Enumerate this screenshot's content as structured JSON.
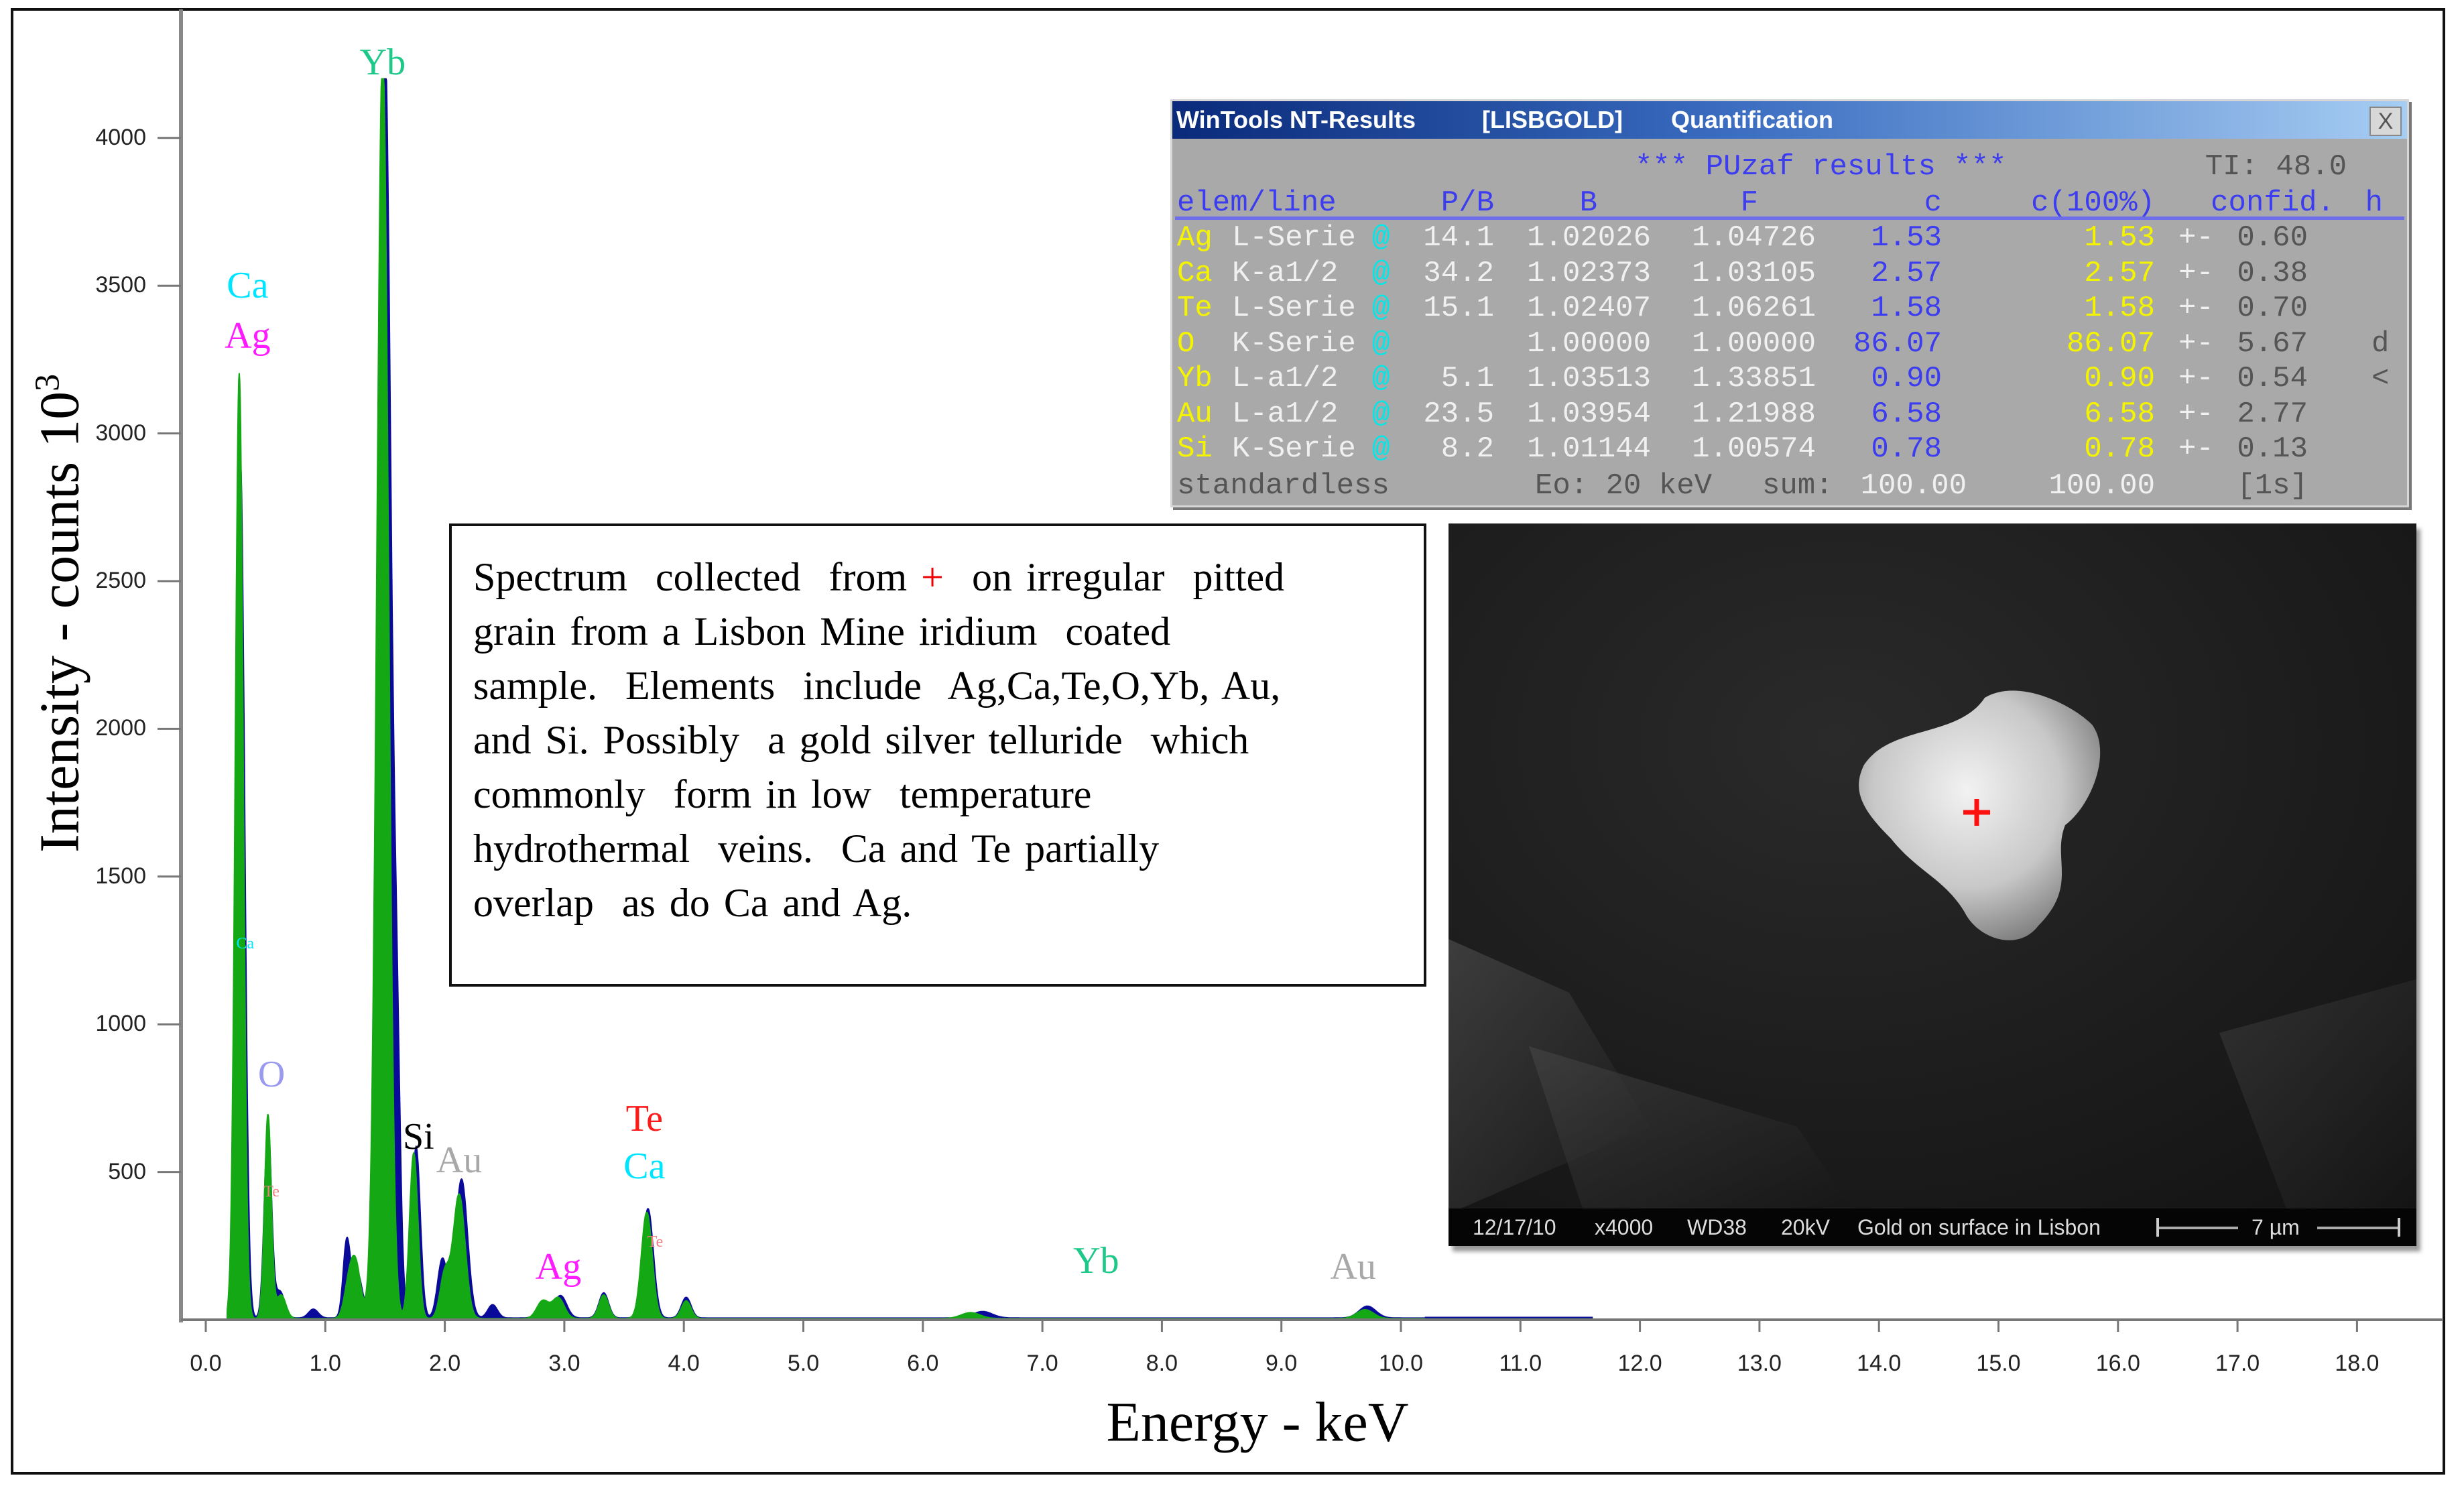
{
  "chart_data": {
    "type": "area",
    "title": "",
    "xlabel": "Energy - keV",
    "ylabel_main": "Intensity - counts 10",
    "ylabel_sup": "3",
    "xlim": [
      -0.3,
      19.0
    ],
    "ylim": [
      0,
      4200
    ],
    "x_ticks": [
      "0.0",
      "1.0",
      "2.0",
      "3.0",
      "4.0",
      "5.0",
      "6.0",
      "7.0",
      "8.0",
      "9.0",
      "10.0",
      "11.0",
      "12.0",
      "13.0",
      "14.0",
      "15.0",
      "16.0",
      "17.0",
      "18.0"
    ],
    "y_ticks": [
      "500",
      "1000",
      "1500",
      "2000",
      "2500",
      "3000",
      "3500",
      "4000"
    ],
    "series": [
      {
        "name": "spectrum-overlay",
        "color": "#0a0a9a",
        "peaks": [
          [
            0.29,
            2900,
            0.035
          ],
          [
            0.52,
            650,
            0.03
          ],
          [
            0.62,
            90,
            0.04
          ],
          [
            0.9,
            30,
            0.04
          ],
          [
            1.18,
            260,
            0.03
          ],
          [
            1.27,
            150,
            0.04
          ],
          [
            1.5,
            4300,
            0.05
          ],
          [
            1.6,
            700,
            0.03
          ],
          [
            1.76,
            580,
            0.035
          ],
          [
            1.98,
            200,
            0.04
          ],
          [
            2.14,
            470,
            0.05
          ],
          [
            2.4,
            45,
            0.04
          ],
          [
            2.83,
            55,
            0.05
          ],
          [
            2.97,
            75,
            0.05
          ],
          [
            3.33,
            85,
            0.04
          ],
          [
            3.7,
            370,
            0.045
          ],
          [
            4.02,
            70,
            0.04
          ],
          [
            6.5,
            22,
            0.08
          ],
          [
            9.72,
            40,
            0.07
          ],
          [
            11.5,
            12,
            0.1
          ]
        ]
      },
      {
        "name": "spectrum",
        "color": "#14a814",
        "peaks": [
          [
            0.28,
            3200,
            0.033
          ],
          [
            0.52,
            690,
            0.028
          ],
          [
            0.63,
            80,
            0.04
          ],
          [
            1.2,
            120,
            0.04
          ],
          [
            1.26,
            160,
            0.04
          ],
          [
            1.48,
            4300,
            0.048
          ],
          [
            1.74,
            560,
            0.035
          ],
          [
            2.0,
            150,
            0.04
          ],
          [
            2.12,
            420,
            0.05
          ],
          [
            2.82,
            60,
            0.05
          ],
          [
            2.95,
            70,
            0.05
          ],
          [
            3.33,
            80,
            0.04
          ],
          [
            3.69,
            360,
            0.045
          ],
          [
            4.02,
            60,
            0.04
          ],
          [
            6.4,
            20,
            0.08
          ],
          [
            9.7,
            30,
            0.07
          ]
        ]
      }
    ],
    "annotations": [
      {
        "text": "Yb",
        "keV": 1.48,
        "counts": 4290,
        "color": "#1ec888"
      },
      {
        "text": "Ca",
        "keV": 0.35,
        "counts": 3500,
        "color": "#00e5ff"
      },
      {
        "text": "Ag",
        "keV": 0.35,
        "counts": 3330,
        "color": "#ff1aff"
      },
      {
        "text": "Ca",
        "keV": 0.33,
        "counts": 1270,
        "color": "#00e5ff",
        "small": true
      },
      {
        "text": "O",
        "keV": 0.55,
        "counts": 830,
        "color": "#9a9af0"
      },
      {
        "text": "Te",
        "keV": 0.55,
        "counts": 430,
        "color": "#f08080",
        "small": true
      },
      {
        "text": "Si",
        "keV": 1.78,
        "counts": 620,
        "color": "#000000"
      },
      {
        "text": "Au",
        "keV": 2.12,
        "counts": 540,
        "color": "#a8a8a8"
      },
      {
        "text": "Te",
        "keV": 3.67,
        "counts": 680,
        "color": "#ff1a1a"
      },
      {
        "text": "Ca",
        "keV": 3.67,
        "counts": 520,
        "color": "#00e5ff"
      },
      {
        "text": "Te",
        "keV": 3.76,
        "counts": 260,
        "color": "#f08080",
        "small": true
      },
      {
        "text": "Ag",
        "keV": 2.95,
        "counts": 180,
        "color": "#ff1aff"
      },
      {
        "text": "Yb",
        "keV": 7.45,
        "counts": 200,
        "color": "#1ec888"
      },
      {
        "text": "Au",
        "keV": 9.6,
        "counts": 180,
        "color": "#a8a8a8"
      }
    ]
  },
  "note": {
    "line1_pre": "Spectrum  collected  from ",
    "line1_plus": "+",
    "line1_post": "  on irregular  pitted",
    "lines": [
      "grain from a Lisbon Mine iridium  coated",
      "sample.  Elements  include  Ag,Ca,Te,O,Yb, Au,",
      "and Si. Possibly  a gold silver telluride  which",
      "commonly  form in low  temperature",
      "hydrothermal  veins.  Ca and Te partially",
      "overlap  as do Ca and Ag."
    ]
  },
  "quant": {
    "title_app": "WinTools NT-Results",
    "title_file": "[LISBGOLD]",
    "title_mode": "Quantification",
    "close": "X",
    "results_title": "*** PUzaf results ***",
    "ti": "TI: 48.0",
    "headers": [
      "elem/line",
      "P/B",
      "B",
      "F",
      "c",
      "c(100%)",
      "confid.",
      "h"
    ],
    "rows": [
      {
        "el": "Ag",
        "line": "L-Serie",
        "pb": "14.1",
        "b": "1.02026",
        "f": "1.04726",
        "c": "1.53",
        "c100": "1.53",
        "pm": "+-",
        "conf": "0.60",
        "h": ""
      },
      {
        "el": "Ca",
        "line": "K-a1/2",
        "pb": "34.2",
        "b": "1.02373",
        "f": "1.03105",
        "c": "2.57",
        "c100": "2.57",
        "pm": "+-",
        "conf": "0.38",
        "h": ""
      },
      {
        "el": "Te",
        "line": "L-Serie",
        "pb": "15.1",
        "b": "1.02407",
        "f": "1.06261",
        "c": "1.58",
        "c100": "1.58",
        "pm": "+-",
        "conf": "0.70",
        "h": ""
      },
      {
        "el": "O",
        "line": "K-Serie",
        "pb": "",
        "b": "1.00000",
        "f": "1.00000",
        "c": "86.07",
        "c100": "86.07",
        "pm": "+-",
        "conf": "5.67",
        "h": "d"
      },
      {
        "el": "Yb",
        "line": "L-a1/2",
        "pb": "5.1",
        "b": "1.03513",
        "f": "1.33851",
        "c": "0.90",
        "c100": "0.90",
        "pm": "+-",
        "conf": "0.54",
        "h": "<"
      },
      {
        "el": "Au",
        "line": "L-a1/2",
        "pb": "23.5",
        "b": "1.03954",
        "f": "1.21988",
        "c": "6.58",
        "c100": "6.58",
        "pm": "+-",
        "conf": "2.77",
        "h": ""
      },
      {
        "el": "Si",
        "line": "K-Serie",
        "pb": "8.2",
        "b": "1.01144",
        "f": "1.00574",
        "c": "0.78",
        "c100": "0.78",
        "pm": "+-",
        "conf": "0.13",
        "h": ""
      }
    ],
    "marker": "@",
    "footer": {
      "mode": "standardless",
      "eo": "Eo: 20 keV",
      "sum_label": "sum:",
      "sum": "100.00",
      "total": "100.00",
      "time": "[1s]"
    }
  },
  "sem": {
    "date": "12/17/10",
    "mag": "x4000",
    "wd": "WD38",
    "kv": "20kV",
    "desc": "Gold on surface in Lisbon",
    "scale": "7 µm",
    "marker": "+"
  }
}
